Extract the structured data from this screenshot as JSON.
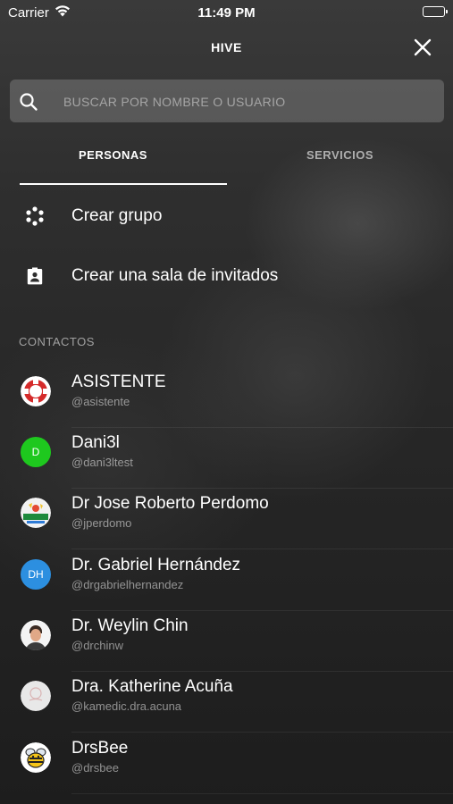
{
  "status_bar": {
    "carrier": "Carrier",
    "time": "11:49 PM"
  },
  "header": {
    "title": "HIVE",
    "close_icon": "close-icon"
  },
  "search": {
    "placeholder": "BUSCAR POR NOMBRE O USUARIO",
    "value": "",
    "icon": "search-icon"
  },
  "tabs": [
    {
      "label": "PERSONAS",
      "active": true
    },
    {
      "label": "SERVICIOS",
      "active": false
    }
  ],
  "actions": [
    {
      "label": "Crear grupo",
      "icon": "group-dots-icon"
    },
    {
      "label": "Crear una sala de invitados",
      "icon": "guest-badge-icon"
    }
  ],
  "section": {
    "contacts_header": "CONTACTOS"
  },
  "contacts": [
    {
      "name": "ASISTENTE",
      "handle": "@asistente",
      "avatar": "lifebuoy-icon"
    },
    {
      "name": "Dani3l",
      "handle": "@dani3ltest",
      "avatar_initials": "D",
      "avatar_color": "#1ec81e"
    },
    {
      "name": "Dr Jose Roberto Perdomo",
      "handle": "@jperdomo",
      "avatar": "llama-logo"
    },
    {
      "name": "Dr. Gabriel Hernández",
      "handle": "@drgabrielhernandez",
      "avatar_initials": "DH",
      "avatar_color": "#2c8fe0"
    },
    {
      "name": "Dr. Weylin Chin",
      "handle": "@drchinw",
      "avatar": "person-photo"
    },
    {
      "name": "Dra. Katherine Acuña",
      "handle": "@kamedic.dra.acuna",
      "avatar": "logo-placeholder"
    },
    {
      "name": "DrsBee",
      "handle": "@drsbee",
      "avatar": "bee-icon"
    }
  ],
  "colors": {
    "accent": "#ffffff",
    "green_avatar": "#1ec81e",
    "blue_avatar": "#2c8fe0"
  }
}
